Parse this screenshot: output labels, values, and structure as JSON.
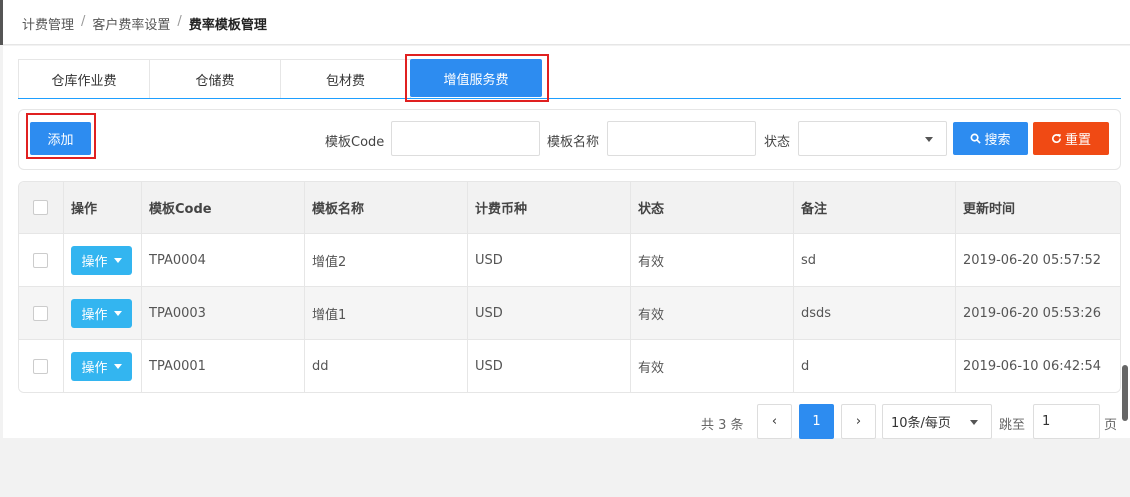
{
  "breadcrumb": {
    "items": [
      "计费管理",
      "客户费率设置"
    ],
    "current": "费率模板管理",
    "separator": "/"
  },
  "tabs": [
    {
      "label": "仓库作业费"
    },
    {
      "label": "仓储费"
    },
    {
      "label": "包材费"
    },
    {
      "label": "增值服务费",
      "active": true
    }
  ],
  "toolbar": {
    "add_label": "添加",
    "code_label": "模板Code",
    "code_value": "",
    "name_label": "模板名称",
    "name_value": "",
    "status_label": "状态",
    "status_value": "",
    "search_label": "搜索",
    "reset_label": "重置"
  },
  "table": {
    "columns": [
      "操作",
      "模板Code",
      "模板名称",
      "计费币种",
      "状态",
      "备注",
      "更新时间"
    ],
    "action_label": "操作",
    "rows": [
      {
        "code": "TPA0004",
        "name": "增值2",
        "currency": "USD",
        "status": "有效",
        "remark": "sd",
        "updated": "2019-06-20 05:57:52"
      },
      {
        "code": "TPA0003",
        "name": "增值1",
        "currency": "USD",
        "status": "有效",
        "remark": "dsds",
        "updated": "2019-06-20 05:53:26"
      },
      {
        "code": "TPA0001",
        "name": "dd",
        "currency": "USD",
        "status": "有效",
        "remark": "d",
        "updated": "2019-06-10 06:42:54"
      }
    ]
  },
  "pagination": {
    "total_text": "共 3 条",
    "prev": "‹",
    "next": "›",
    "current_page": "1",
    "page_size": "10条/每页",
    "jump_label": "跳至",
    "jump_value": "1",
    "page_suffix": "页"
  },
  "colors": {
    "primary": "#2d8cf0",
    "reset": "#f04a14",
    "action": "#33b5f0",
    "highlight": "#e02020"
  }
}
